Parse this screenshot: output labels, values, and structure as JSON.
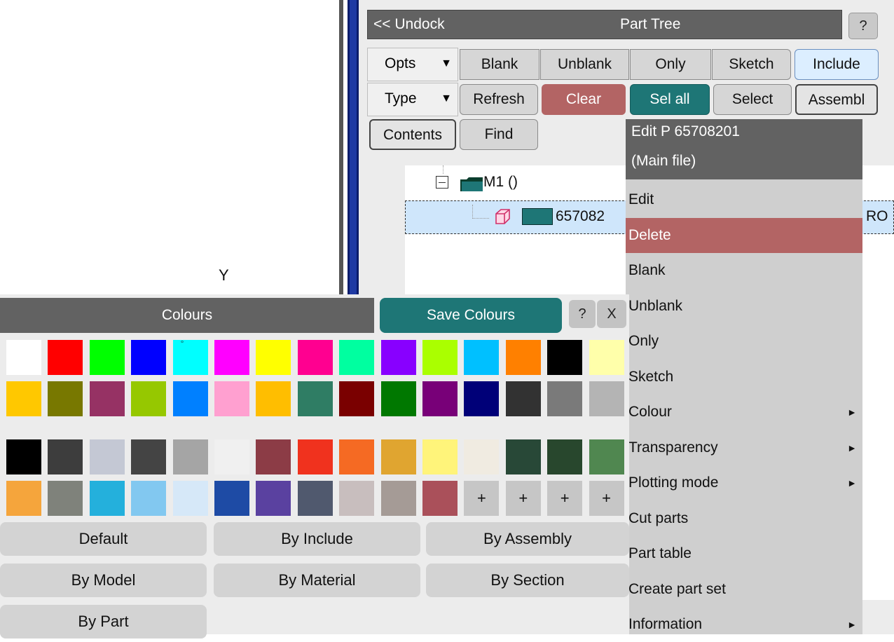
{
  "viewport": {
    "axis_label": "Y"
  },
  "part_tree": {
    "undock_label": "<< Undock",
    "title": "Part Tree",
    "help_label": "?",
    "opts_label": "Opts",
    "type_label": "Type",
    "dropdown_arrow": "▼",
    "buttons": {
      "blank": "Blank",
      "unblank": "Unblank",
      "only": "Only",
      "sketch": "Sketch",
      "include": "Include",
      "refresh": "Refresh",
      "clear": "Clear",
      "sel_all": "Sel all",
      "select": "Select",
      "assembl": "Assembl",
      "contents": "Contents",
      "find": "Find"
    },
    "tree": {
      "root_label": "M1 ()",
      "child_label": "657082",
      "child_suffix": "RO"
    },
    "colors": {
      "clear": "#b36464",
      "sel_all": "#1e7676",
      "folder": "#1e7676"
    }
  },
  "context_menu": {
    "header_line1": "Edit P 65708201",
    "header_line2": "(Main file)",
    "items": [
      {
        "label": "Edit",
        "submenu": false
      },
      {
        "label": "Delete",
        "submenu": false,
        "highlighted": true
      },
      {
        "label": "Blank",
        "submenu": false
      },
      {
        "label": "Unblank",
        "submenu": false
      },
      {
        "label": "Only",
        "submenu": false
      },
      {
        "label": "Sketch",
        "submenu": false
      },
      {
        "label": "Colour",
        "submenu": true
      },
      {
        "label": "Transparency",
        "submenu": true
      },
      {
        "label": "Plotting mode",
        "submenu": true
      },
      {
        "label": "Cut parts",
        "submenu": false
      },
      {
        "label": "Part table",
        "submenu": false
      },
      {
        "label": "Create part set",
        "submenu": false
      },
      {
        "label": "Information",
        "submenu": true
      }
    ],
    "submenu_arrow": "►"
  },
  "colours_panel": {
    "title": "Colours",
    "save_label": "Save Colours",
    "help_label": "?",
    "close_label": "X",
    "selected_marker": "°",
    "plus_label": "+",
    "row1": [
      "#ffffff",
      "#ff0000",
      "#00ff00",
      "#0000ff",
      "#00ffff",
      "#ff00ff",
      "#ffff00",
      "#ff0090",
      "#00ffa0",
      "#8800ff",
      "#aaff00",
      "#00c0ff",
      "#ff8000",
      "#000000",
      "#ffffaa"
    ],
    "row2": [
      "#ffc800",
      "#787800",
      "#963264",
      "#96c800",
      "#0080ff",
      "#ffa0d0",
      "#ffbe00",
      "#2f7d64",
      "#7a0000",
      "#007800",
      "#780078",
      "#000078",
      "#323232",
      "#7a7a7a",
      "#b4b4b4"
    ],
    "row3": [
      "#000000",
      "#3d3d3d",
      "#c4c8d4",
      "#444444",
      "#a5a5a5",
      "#f0f0f0",
      "#8c3c46",
      "#f0321e",
      "#f56a23",
      "#e0a530",
      "#fff47a",
      "#f0ebe1",
      "#284837",
      "#28472d",
      "#508750"
    ],
    "row4": [
      "#f5a53c",
      "#7f827b",
      "#24b0dc",
      "#82c8f0",
      "#d6e8f8",
      "#1e4ba5",
      "#5a41a0",
      "#50596e",
      "#c8bebe",
      "#a59b96",
      "#aa505a",
      "plus",
      "plus",
      "plus",
      "plus"
    ],
    "buttons": [
      [
        "Default",
        "By Include",
        "By Assembly"
      ],
      [
        "By Model",
        "By Material",
        "By Section"
      ],
      [
        "By Part"
      ]
    ]
  }
}
